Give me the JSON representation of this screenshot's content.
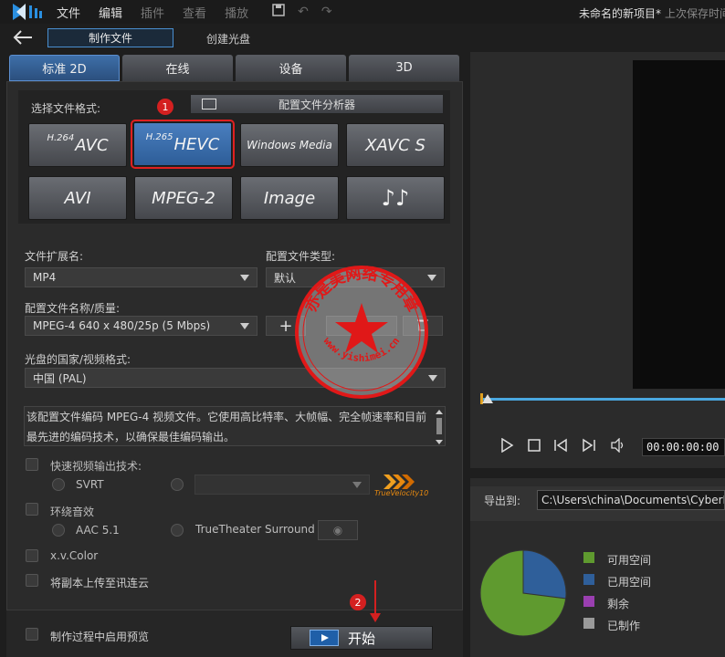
{
  "menubar": {
    "items": [
      {
        "label": "文件",
        "enabled": true
      },
      {
        "label": "编辑",
        "enabled": true
      },
      {
        "label": "插件",
        "enabled": false
      },
      {
        "label": "查看",
        "enabled": false
      },
      {
        "label": "播放",
        "enabled": false
      }
    ],
    "project_title": "未命名的新项目*",
    "saved_status": "上次保存时间"
  },
  "nav": {
    "produce_file": "制作文件",
    "create_disc": "创建光盘"
  },
  "tabs": [
    {
      "label": "标准 2D",
      "active": true
    },
    {
      "label": "在线",
      "active": false
    },
    {
      "label": "设备",
      "active": false
    },
    {
      "label": "3D",
      "active": false
    }
  ],
  "format_section": {
    "label": "选择文件格式:",
    "profile_analyzer": "配置文件分析器",
    "marker1": "1",
    "buttons": [
      {
        "prefix": "H.264",
        "label": "AVC",
        "selected": false
      },
      {
        "prefix": "H.265",
        "label": "HEVC",
        "selected": true
      },
      {
        "prefix": "",
        "label": "Windows Media",
        "selected": false
      },
      {
        "prefix": "",
        "label": "XAVC S",
        "selected": false
      },
      {
        "prefix": "",
        "label": "AVI",
        "selected": false
      },
      {
        "prefix": "",
        "label": "MPEG-2",
        "selected": false
      },
      {
        "prefix": "",
        "label": "Image",
        "selected": false
      },
      {
        "prefix": "",
        "label": "♪♪",
        "selected": false
      }
    ]
  },
  "settings": {
    "ext_label": "文件扩展名:",
    "ext_value": "MP4",
    "profile_type_label": "配置文件类型:",
    "profile_type_value": "默认",
    "profile_name_label": "配置文件名称/质量:",
    "profile_name_value": "MPEG-4 640 x 480/25p (5 Mbps)",
    "add_symbol": "+",
    "disc_label": "光盘的国家/视频格式:",
    "disc_value": "中国 (PAL)",
    "description_line1": "该配置文件编码 MPEG-4 视频文件。它使用高比特率、大帧幅、完全帧速率和目前",
    "description_line2": "最先进的编码技术，以确保最佳编码输出。"
  },
  "options": {
    "fast_render": "快速视频输出技术:",
    "svrt": "SVRT",
    "truevelocity_brand": "TrueVelocity10",
    "surround": "环绕音效",
    "aac": "AAC 5.1",
    "truetheater": "TrueTheater Surround",
    "xvcolor": "x.v.Color",
    "upload_cloud": "将副本上传至讯连云",
    "preview_during": "制作过程中启用预览"
  },
  "start": {
    "label": "开始",
    "marker2": "2"
  },
  "player": {
    "timecode": "00:00:00:00"
  },
  "export": {
    "label": "导出到:",
    "path": "C:\\Users\\china\\Documents\\CyberLink"
  },
  "disk": {
    "legend": [
      {
        "label": "可用空间",
        "color": "#5f9a2f"
      },
      {
        "label": "已用空间",
        "color": "#2f5f9a"
      },
      {
        "label": "剩余",
        "color": "#9a3fb0"
      },
      {
        "label": "已制作",
        "color": "#9a9a9a"
      }
    ],
    "used_fraction": 0.27
  },
  "watermark": {
    "outer_text": "亦是美网络专用章",
    "inner_text": "www.yishimei.cn"
  },
  "colors": {
    "accent": "#4a8fd0",
    "highlight_red": "#d42020"
  }
}
